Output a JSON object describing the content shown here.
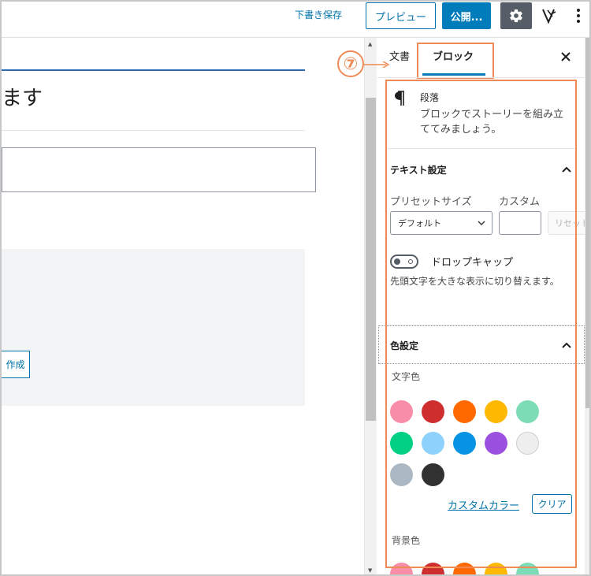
{
  "topbar": {
    "save_draft": "下書き保存",
    "preview": "プレビュー",
    "publish": "公開...",
    "settings_icon": "gear-icon",
    "plugin_icon": "plugin-v-icon",
    "more_icon": "vertical-ellipsis-icon"
  },
  "content": {
    "heading_fragment": "ます",
    "create_button": "作成"
  },
  "annotation": {
    "number": "⑦",
    "color": "#ef8a54"
  },
  "sidebar": {
    "tabs": [
      {
        "label": "文書",
        "active": false
      },
      {
        "label": "ブロック",
        "active": true
      }
    ],
    "close_icon": "close-icon",
    "block": {
      "icon": "paragraph-icon",
      "name": "段落",
      "description": "ブロックでストーリーを組み立ててみましょう。"
    },
    "text_settings": {
      "title": "テキスト設定",
      "preset_size_label": "プリセットサイズ",
      "preset_size_value": "デフォルト",
      "custom_label": "カスタム",
      "custom_value": "",
      "reset_label": "リセット",
      "drop_cap_label": "ドロップキャップ",
      "drop_cap_enabled": false,
      "drop_cap_help": "先頭文字を大きな表示に切り替えます。"
    },
    "color_settings": {
      "title": "色設定",
      "text_color_label": "文字色",
      "palette": [
        "#f78da7",
        "#cf2e2e",
        "#ff6900",
        "#fcb900",
        "#7bdcb5",
        "#00d084",
        "#8ed1fc",
        "#0693e3",
        "#9b51e0",
        "#eeeeee",
        "#abb8c3",
        "#313131"
      ],
      "custom_color_link": "カスタムカラー",
      "clear_button": "クリア",
      "background_color_label": "背景色"
    }
  }
}
